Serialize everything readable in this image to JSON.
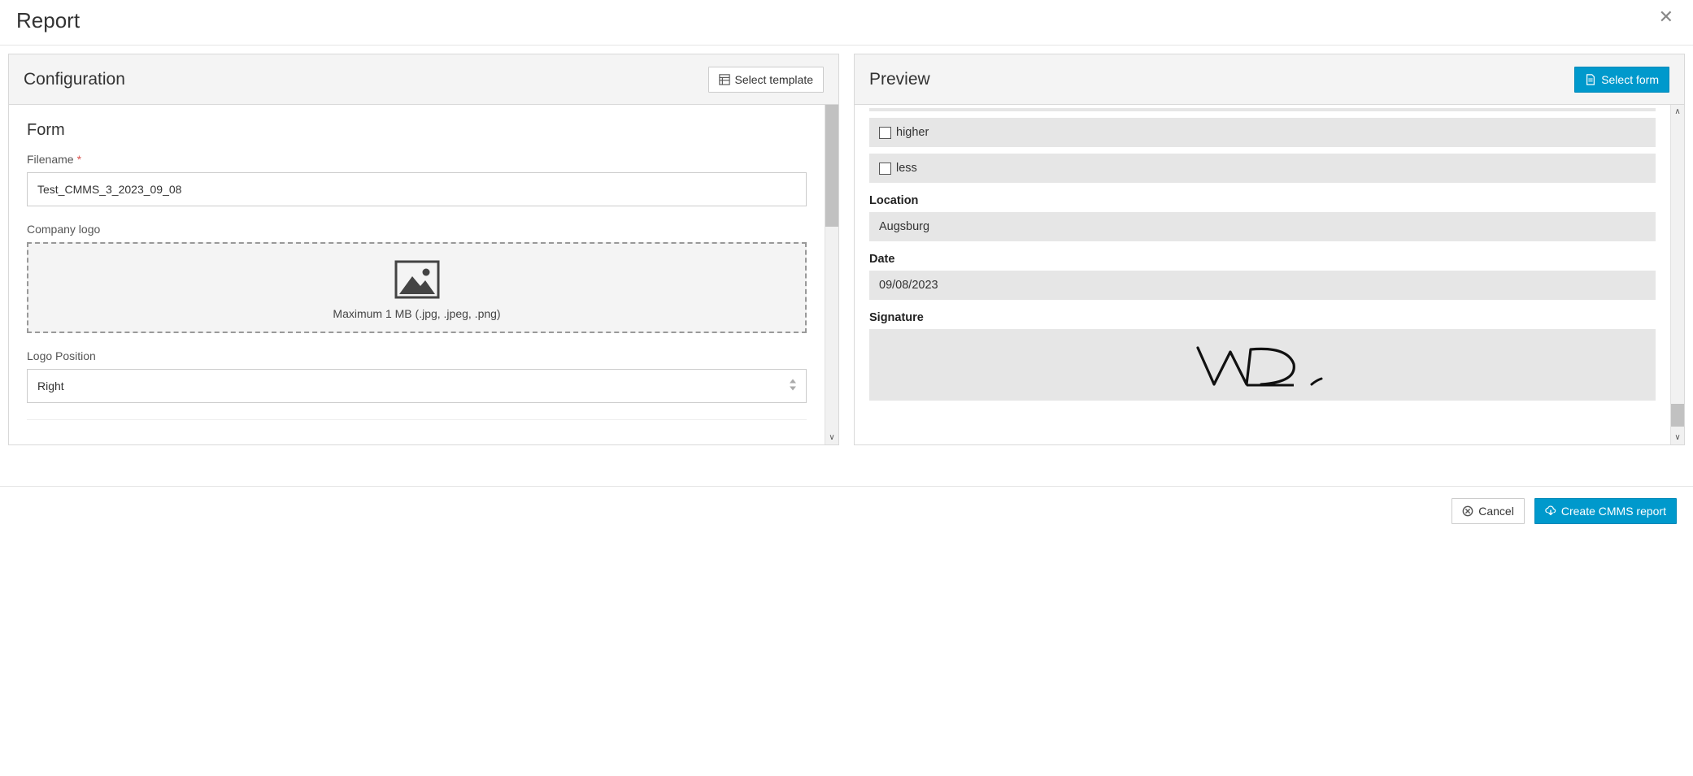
{
  "modal": {
    "title": "Report"
  },
  "configuration": {
    "title": "Configuration",
    "select_template_label": "Select template",
    "form_section_title": "Form",
    "filename_label": "Filename",
    "filename_value": "Test_CMMS_3_2023_09_08",
    "company_logo_label": "Company logo",
    "logo_dropzone_hint": "Maximum 1 MB (.jpg, .jpeg, .png)",
    "logo_position_label": "Logo Position",
    "logo_position_value": "Right"
  },
  "preview": {
    "title": "Preview",
    "select_form_label": "Select form",
    "checkbox_higher_label": "higher",
    "checkbox_less_label": "less",
    "location_label": "Location",
    "location_value": "Augsburg",
    "date_label": "Date",
    "date_value": "09/08/2023",
    "signature_label": "Signature"
  },
  "footer": {
    "cancel_label": "Cancel",
    "create_label": "Create CMMS report"
  }
}
